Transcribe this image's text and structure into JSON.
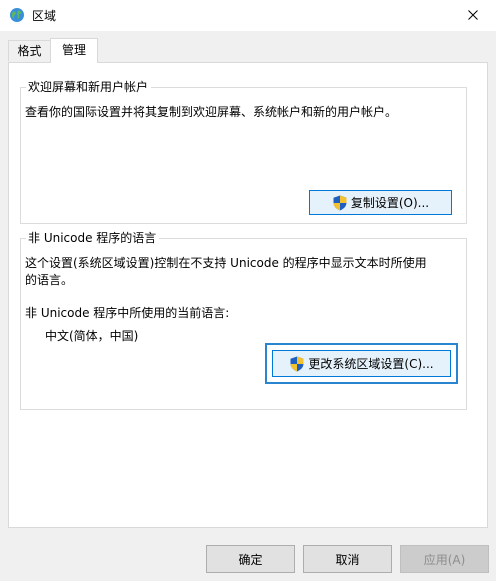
{
  "window": {
    "title": "区域",
    "globe_icon": "globe-icon",
    "close_icon": "close-icon"
  },
  "tabs": [
    {
      "label": "格式",
      "active": false
    },
    {
      "label": "管理",
      "active": true
    }
  ],
  "welcome_group": {
    "title": "欢迎屏幕和新用户帐户",
    "description": "查看你的国际设置并将其复制到欢迎屏幕、系统帐户和新的用户帐户。",
    "copy_button_label": "复制设置(O)...",
    "shield_icon": "uac-shield-icon"
  },
  "unicode_group": {
    "title": "非 Unicode 程序的语言",
    "description_line1": "这个设置(系统区域设置)控制在不支持 Unicode 的程序中显示文本时所使用",
    "description_line2": "的语言。",
    "current_label": "非 Unicode 程序中所使用的当前语言:",
    "current_value": "中文(简体，中国)",
    "change_button_label": "更改系统区域设置(C)..."
  },
  "footer": {
    "ok_label": "确定",
    "cancel_label": "取消",
    "apply_label": "应用(A)"
  },
  "colors": {
    "accent": "#0078d7",
    "focus_ring": "#2a85d0"
  }
}
